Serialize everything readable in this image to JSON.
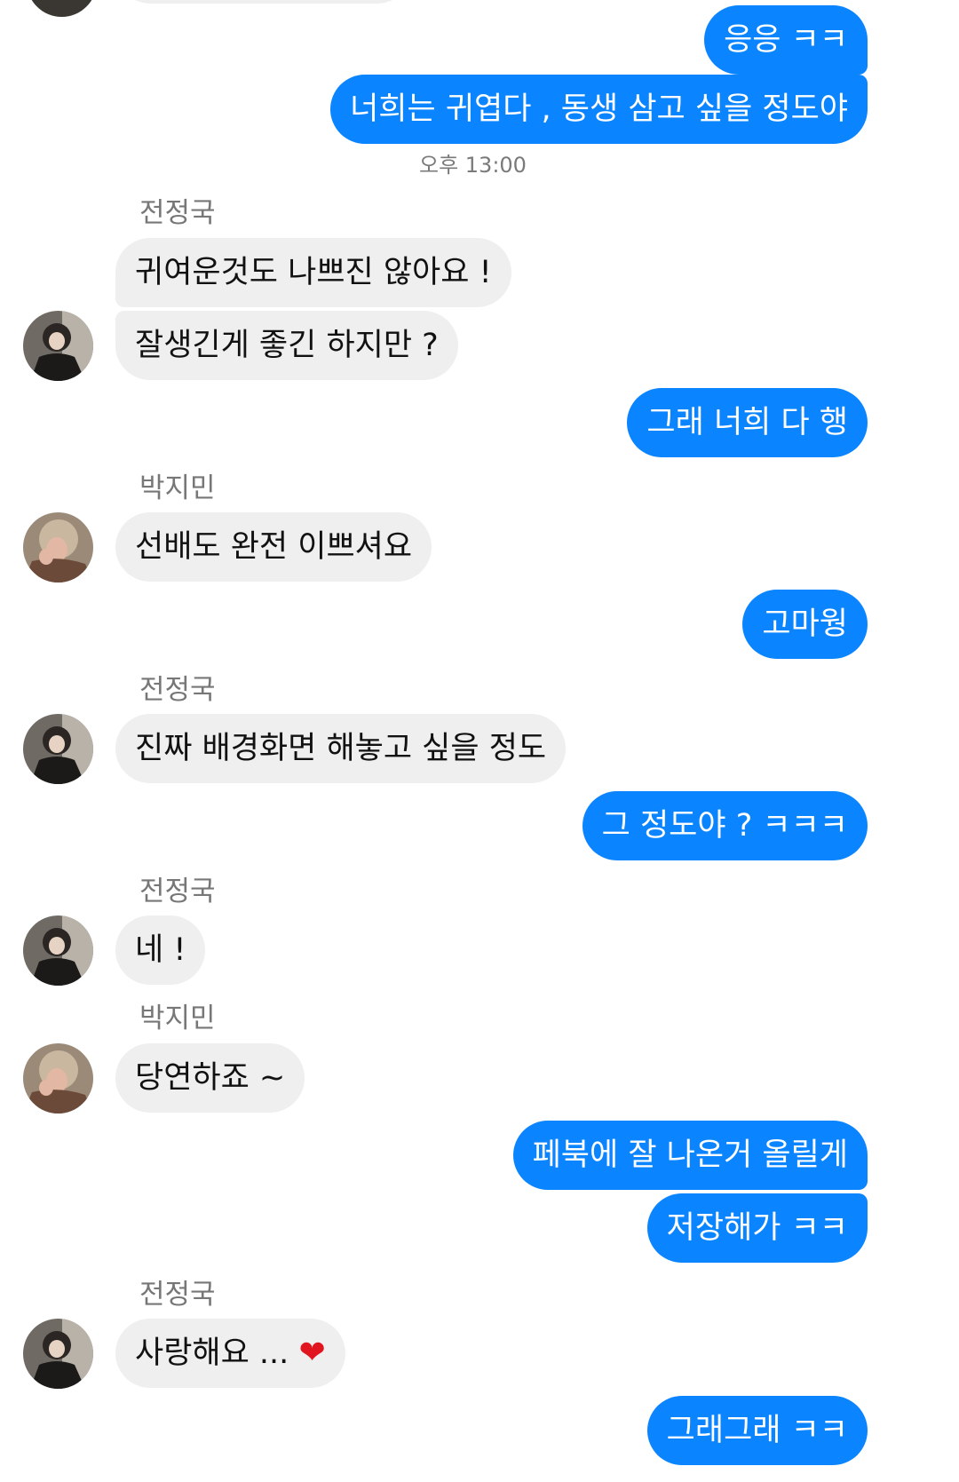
{
  "conversation": {
    "timestamp": "오후 13:00",
    "messages": [
      {
        "from": "me",
        "text": "응응 ㅋㅋ"
      },
      {
        "from": "me",
        "text": "너희는 귀엽다 , 동생 삼고 싶을 정도야"
      },
      {
        "from": "전정국",
        "text": "귀여운것도 나쁘진 않아요 !"
      },
      {
        "from": "전정국",
        "text": "잘생긴게 좋긴 하지만 ?"
      },
      {
        "from": "me",
        "text": "그래 너희 다 행"
      },
      {
        "from": "박지민",
        "text": "선배도 완전 이쁘셔요"
      },
      {
        "from": "me",
        "text": "고마웡"
      },
      {
        "from": "전정국",
        "text": "진짜 배경화면 해놓고 싶을 정도"
      },
      {
        "from": "me",
        "text": "그 정도야 ? ㅋㅋㅋ"
      },
      {
        "from": "전정국",
        "text": "네 !"
      },
      {
        "from": "박지민",
        "text": "당연하죠 ~"
      },
      {
        "from": "me",
        "text": "페북에 잘 나온거 올릴게"
      },
      {
        "from": "me",
        "text": "저장해가 ㅋㅋ"
      },
      {
        "from": "전정국",
        "text": "사랑해요 ...",
        "emoji": "❤"
      },
      {
        "from": "me",
        "text": "그래그래 ㅋㅋ"
      }
    ],
    "senders": {
      "jk": "전정국",
      "jm": "박지민"
    }
  },
  "theme": {
    "outgoing_bubble": "#0a84ff",
    "incoming_bubble": "#efefef",
    "heart": "#e0151f"
  },
  "icons": {
    "avatar_jk": "avatar-photo-jungkook",
    "avatar_jm": "avatar-photo-jimin",
    "heart": "red-heart-emoji"
  }
}
